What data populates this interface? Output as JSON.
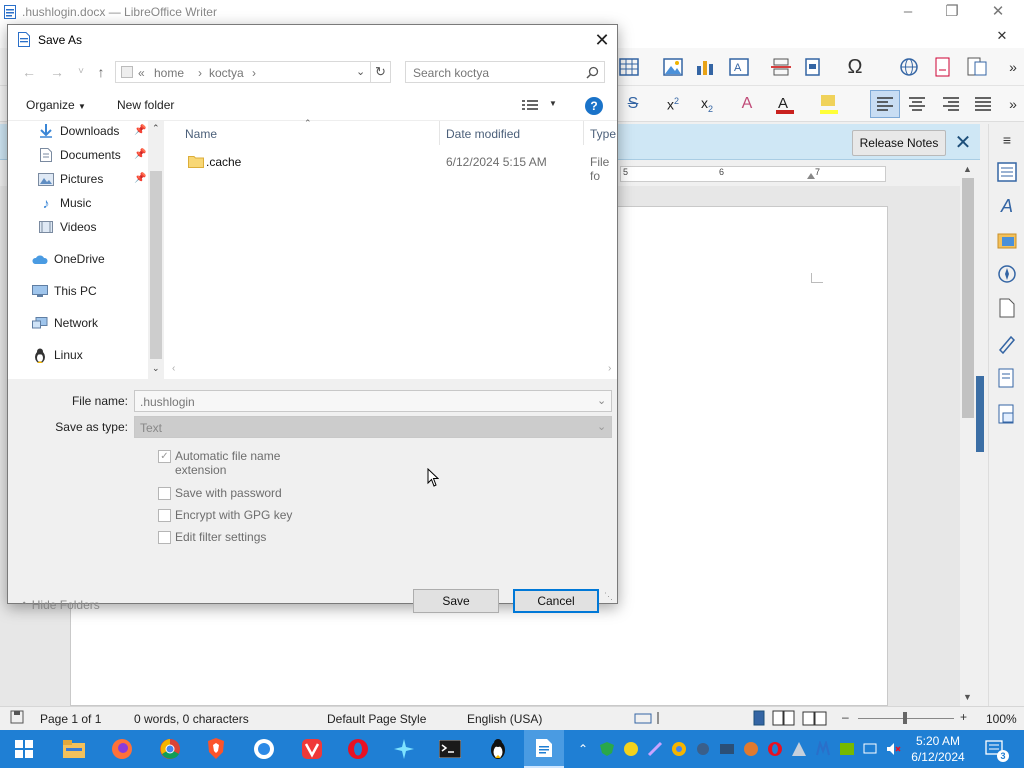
{
  "writer": {
    "window_title": ".hushlogin.docx — LibreOffice Writer",
    "infobar_button": "Release Notes",
    "ruler_marks": [
      "5",
      "6",
      "7"
    ],
    "status": {
      "page": "Page 1 of 1",
      "words": "0 words, 0 characters",
      "page_style": "Default Page Style",
      "language": "English (USA)",
      "zoom": "100%"
    }
  },
  "dialog": {
    "title": "Save As",
    "breadcrumb": [
      "«",
      "home",
      "koctya"
    ],
    "search_placeholder": "Search koctya",
    "organize_label": "Organize",
    "new_folder_label": "New folder",
    "help_label": "?",
    "nav_items": [
      {
        "label": "Downloads",
        "icon": "download-icon",
        "pinned": true
      },
      {
        "label": "Documents",
        "icon": "documents-icon",
        "pinned": true
      },
      {
        "label": "Pictures",
        "icon": "pictures-icon",
        "pinned": true
      },
      {
        "label": "Music",
        "icon": "music-icon",
        "pinned": false
      },
      {
        "label": "Videos",
        "icon": "videos-icon",
        "pinned": false
      },
      {
        "label": "OneDrive",
        "icon": "cloud-icon",
        "pinned": false
      },
      {
        "label": "This PC",
        "icon": "computer-icon",
        "pinned": false
      },
      {
        "label": "Network",
        "icon": "network-icon",
        "pinned": false
      },
      {
        "label": "Linux",
        "icon": "linux-icon",
        "pinned": false
      }
    ],
    "columns": [
      "Name",
      "Date modified",
      "Type"
    ],
    "files": [
      {
        "name": ".cache",
        "date": "6/12/2024 5:15 AM",
        "type": "File fo"
      }
    ],
    "file_name_label": "File name:",
    "file_name_value": ".hushlogin",
    "save_as_type_label": "Save as type:",
    "save_as_type_value": "Text",
    "options": [
      {
        "label": "Automatic file name extension",
        "line1": "Automatic file name",
        "line2": "extension",
        "checked": true
      },
      {
        "label": "Save with password",
        "checked": false
      },
      {
        "label": "Encrypt with GPG key",
        "checked": false
      },
      {
        "label": "Edit filter settings",
        "checked": false
      }
    ],
    "hide_folders_label": "Hide Folders",
    "save_label": "Save",
    "cancel_label": "Cancel"
  },
  "taskbar": {
    "clock_time": "5:20 AM",
    "clock_date": "6/12/2024",
    "notification_count": "3"
  },
  "colors": {
    "taskbar": "#1f7fd4",
    "infobar": "#cfe7f5",
    "accent": "#1a73c9"
  }
}
